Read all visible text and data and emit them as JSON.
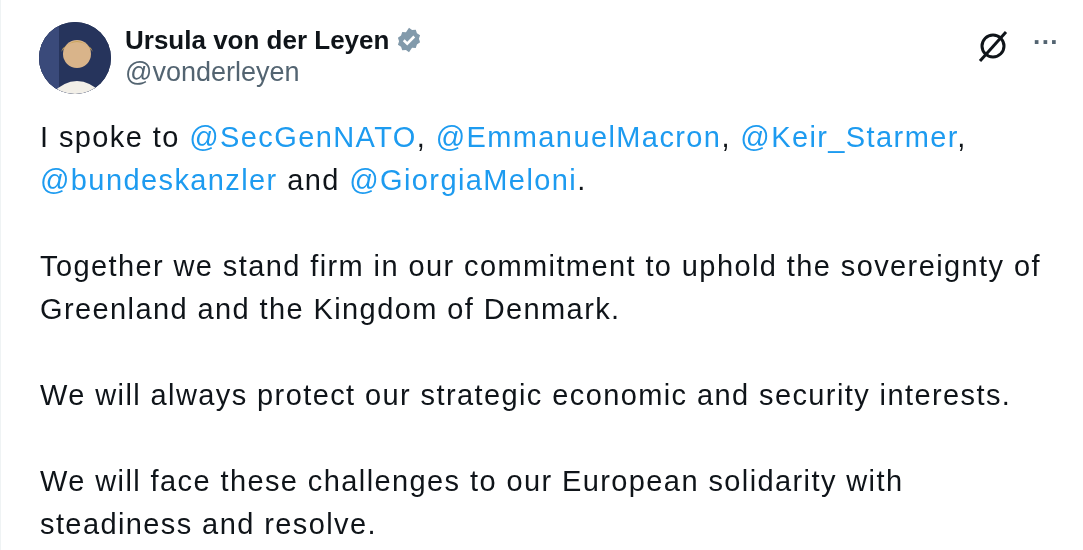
{
  "author": {
    "name": "Ursula von der Leyen",
    "verified": true,
    "handle": "@vonderleyen"
  },
  "actions": [
    "···"
  ],
  "paragraphs": [
    [
      {
        "kind": "text",
        "text": "I spoke to "
      },
      {
        "kind": "mention",
        "text": "@SecGenNATO"
      },
      {
        "kind": "text",
        "text": ", "
      },
      {
        "kind": "mention",
        "text": "@EmmanuelMacron"
      },
      {
        "kind": "text",
        "text": ", "
      },
      {
        "kind": "mention",
        "text": "@Keir_Starmer"
      },
      {
        "kind": "text",
        "text": ", "
      },
      {
        "kind": "mention",
        "text": "@bundeskanzler"
      },
      {
        "kind": "text",
        "text": " and "
      },
      {
        "kind": "mention",
        "text": "@GiorgiaMeloni"
      },
      {
        "kind": "text",
        "text": "."
      }
    ],
    [
      {
        "kind": "text",
        "text": "Together we stand firm in our commitment to uphold the sovereignty of Greenland and the Kingdom of Denmark."
      }
    ],
    [
      {
        "kind": "text",
        "text": "We will always protect our strategic economic and security interests."
      }
    ],
    [
      {
        "kind": "text",
        "text": "We will face these challenges to our European solidarity with steadiness and resolve."
      }
    ]
  ]
}
